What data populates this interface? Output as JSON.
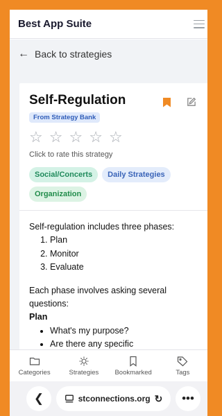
{
  "app": {
    "title": "Best App Suite"
  },
  "nav": {
    "back_label": "Back to strategies"
  },
  "strategy": {
    "title": "Self-Regulation",
    "source_badge": "From Strategy Bank",
    "rating": {
      "value": 0,
      "max": 5,
      "hint": "Click to rate this strategy"
    },
    "tags": [
      "Social/Concerts",
      "Daily Strategies",
      "Organization"
    ],
    "intro": "Self-regulation includes three phases:",
    "phases": [
      "Plan",
      "Monitor",
      "Evaluate"
    ],
    "para2": "Each phase involves asking several questions:",
    "section_heading": "Plan",
    "plan_questions": [
      "What's my purpose?",
      "Are there any specific"
    ]
  },
  "bottom_nav": {
    "items": [
      {
        "label": "Categories",
        "icon": "folder-icon"
      },
      {
        "label": "Strategies",
        "icon": "lightbulb-icon"
      },
      {
        "label": "Bookmarked",
        "icon": "bookmark-icon"
      },
      {
        "label": "Tags",
        "icon": "tag-icon"
      }
    ]
  },
  "browser": {
    "url": "stconnections.org"
  },
  "colors": {
    "frame": "#F08A24",
    "bookmark": "#F08A24"
  }
}
